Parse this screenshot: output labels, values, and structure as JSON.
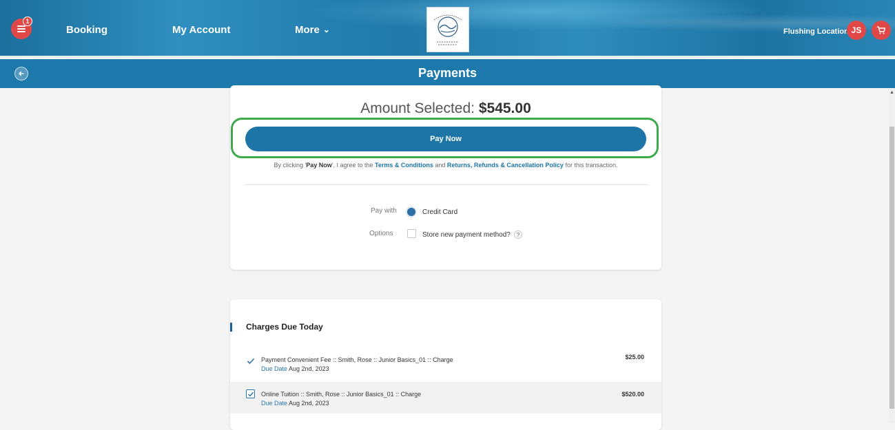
{
  "nav": {
    "menu_badge": "1",
    "booking": "Booking",
    "my_account": "My Account",
    "more": "More",
    "location": "Flushing Location",
    "avatar_initials": "JS",
    "icons": {
      "menu": "menu-icon",
      "chevron": "chevron-down-icon",
      "cart": "cart-icon"
    }
  },
  "title_bar": {
    "title": "Payments",
    "back_icon": "back-arrow-icon"
  },
  "payment": {
    "amount_label": "Amount Selected:",
    "amount_value": "$545.00",
    "pay_now_label": "Pay Now",
    "terms": {
      "prefix": "By clicking '",
      "pay_now": "Pay Now",
      "mid": "', I agree to the ",
      "terms_link": "Terms & Conditions",
      "and": " and ",
      "policy_link": "Returns, Refunds & Cancellation Policy",
      "suffix": " for this transaction."
    },
    "pay_with_label": "Pay with",
    "pay_with_value": "Credit Card",
    "options_label": "Options",
    "store_method_label": "Store new payment method?",
    "help_symbol": "?"
  },
  "charges": {
    "title": "Charges Due Today",
    "due_label": "Due Date",
    "items": [
      {
        "description": "Payment Convenient Fee :: Smith, Rose :: Junior Basics_01 :: Charge",
        "due_date": "Aug 2nd, 2023",
        "amount": "$25.00",
        "checked": true
      },
      {
        "description": "Online Tuition :: Smith, Rose :: Junior Basics_01 :: Charge",
        "due_date": "Aug 2nd, 2023",
        "amount": "$520.00",
        "checked": true
      }
    ]
  },
  "colors": {
    "brand_blue": "#1d79ab",
    "accent_red": "#e04848",
    "highlight_green": "#3caa4a"
  }
}
